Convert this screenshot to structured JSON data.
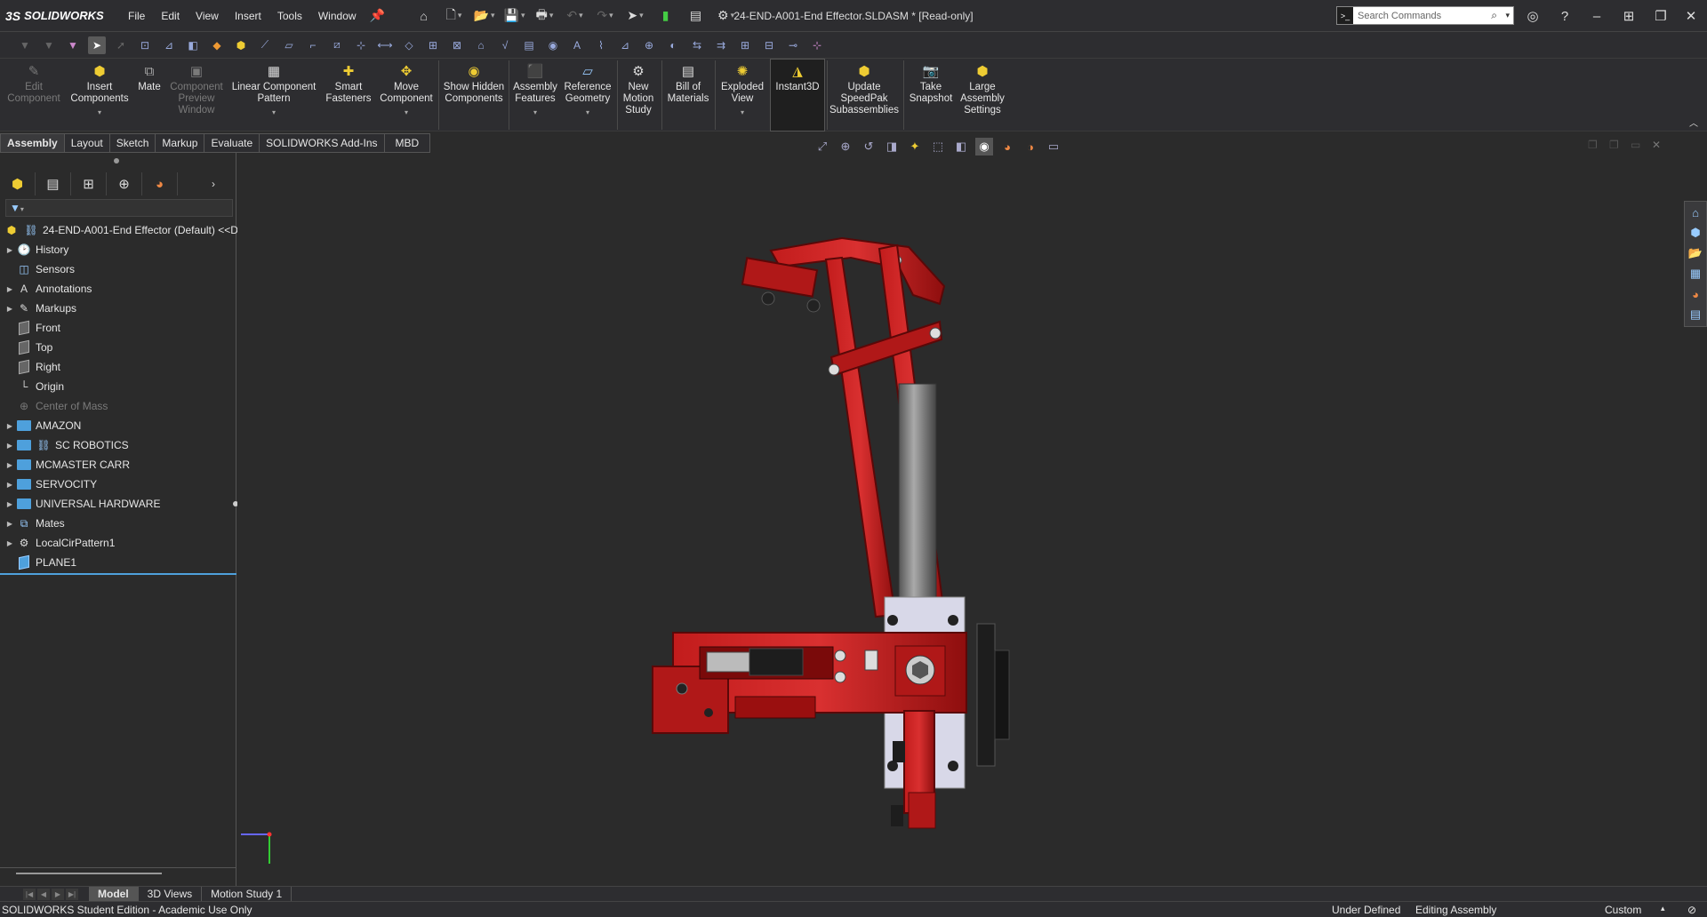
{
  "app": {
    "logo_prefix": "3S",
    "logo_name": "SOLIDWORKS",
    "doc_title": "24-END-A001-End Effector.SLDASM * [Read-only]"
  },
  "menu": [
    "File",
    "Edit",
    "View",
    "Insert",
    "Tools",
    "Window"
  ],
  "search": {
    "placeholder": "Search Commands"
  },
  "commands": [
    {
      "label": "Edit Component",
      "icon": "edit-component-icon",
      "disabled": true
    },
    {
      "label": "Insert Components",
      "icon": "insert-components-icon",
      "disabled": false
    },
    {
      "label": "Mate",
      "icon": "mate-icon",
      "disabled": false
    },
    {
      "label": "Component Preview Window",
      "icon": "component-preview-icon",
      "disabled": true
    },
    {
      "label": "Linear Component Pattern",
      "icon": "linear-pattern-icon",
      "disabled": false
    },
    {
      "label": "Smart Fasteners",
      "icon": "smart-fasteners-icon",
      "disabled": false
    },
    {
      "label": "Move Component",
      "icon": "move-component-icon",
      "disabled": false
    },
    {
      "label": "Show Hidden Components",
      "icon": "show-hidden-icon",
      "disabled": false
    },
    {
      "label": "Assembly Features",
      "icon": "assembly-features-icon",
      "disabled": false
    },
    {
      "label": "Reference Geometry",
      "icon": "reference-geometry-icon",
      "disabled": false
    },
    {
      "label": "New Motion Study",
      "icon": "motion-study-icon",
      "disabled": false
    },
    {
      "label": "Bill of Materials",
      "icon": "bom-icon",
      "disabled": false
    },
    {
      "label": "Exploded View",
      "icon": "exploded-view-icon",
      "disabled": false
    },
    {
      "label": "Instant3D",
      "icon": "instant3d-icon",
      "disabled": false
    },
    {
      "label": "Update SpeedPak Subassemblies",
      "icon": "speedpak-icon",
      "disabled": false
    },
    {
      "label": "Take Snapshot",
      "icon": "snapshot-icon",
      "disabled": false
    },
    {
      "label": "Large Assembly Settings",
      "icon": "large-assembly-icon",
      "disabled": false
    }
  ],
  "cmd_tabs": [
    "Assembly",
    "Layout",
    "Sketch",
    "Markup",
    "Evaluate",
    "SOLIDWORKS Add-Ins",
    "MBD"
  ],
  "tree": {
    "root": "24-END-A001-End Effector (Default) <<D",
    "items": [
      {
        "label": "History"
      },
      {
        "label": "Sensors"
      },
      {
        "label": "Annotations"
      },
      {
        "label": "Markups"
      },
      {
        "label": "Front"
      },
      {
        "label": "Top"
      },
      {
        "label": "Right"
      },
      {
        "label": "Origin"
      },
      {
        "label": "Center of Mass"
      },
      {
        "label": "AMAZON"
      },
      {
        "label": "SC ROBOTICS"
      },
      {
        "label": "MCMASTER CARR"
      },
      {
        "label": "SERVOCITY"
      },
      {
        "label": "UNIVERSAL HARDWARE"
      },
      {
        "label": "Mates"
      },
      {
        "label": "LocalCirPattern1"
      },
      {
        "label": "PLANE1"
      }
    ]
  },
  "bottom_tabs": [
    "Model",
    "3D Views",
    "Motion Study 1"
  ],
  "status": {
    "edition": "SOLIDWORKS Student Edition - Academic Use Only",
    "definition": "Under Defined",
    "mode": "Editing Assembly",
    "units": "Custom"
  },
  "colors": {
    "accent": "#4ea0dc",
    "part_red": "#b01818",
    "part_dark": "#6e0a0a"
  }
}
